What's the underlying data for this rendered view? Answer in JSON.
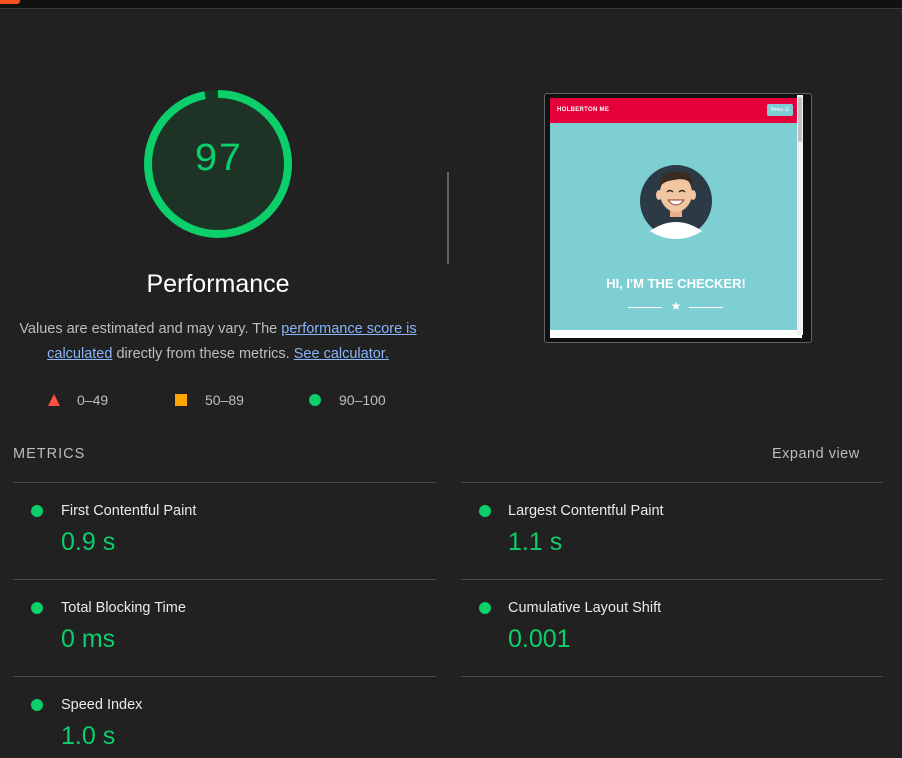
{
  "colors": {
    "pass": "#0cce6b",
    "average": "#ffa400",
    "fail": "#ff4e42",
    "background": "#212121",
    "link": "#8ab4f8"
  },
  "score": {
    "value": "97",
    "title": "Performance",
    "fraction": 0.97
  },
  "description": {
    "prefix": "Values are estimated and may vary. The ",
    "score_link": "performance score is calculated",
    "middle": " directly from these metrics. ",
    "calculator_link": "See calculator."
  },
  "legend": {
    "fail": {
      "range": "0–49",
      "icon": "triangle-icon"
    },
    "average": {
      "range": "50–89",
      "icon": "square-icon"
    },
    "pass": {
      "range": "90–100",
      "icon": "circle-icon"
    }
  },
  "screenshot": {
    "brand": "HOLBERTON ME",
    "menu": "Menu ☰",
    "heading": "HI, I'M THE CHECKER!",
    "divider_icon": "star-icon"
  },
  "metrics": {
    "header": "METRICS",
    "expand": "Expand view",
    "items": [
      {
        "title": "First Contentful Paint",
        "value": "0.9 s"
      },
      {
        "title": "Largest Contentful Paint",
        "value": "1.1 s"
      },
      {
        "title": "Total Blocking Time",
        "value": "0 ms"
      },
      {
        "title": "Cumulative Layout Shift",
        "value": "0.001"
      },
      {
        "title": "Speed Index",
        "value": "1.0 s"
      }
    ]
  }
}
